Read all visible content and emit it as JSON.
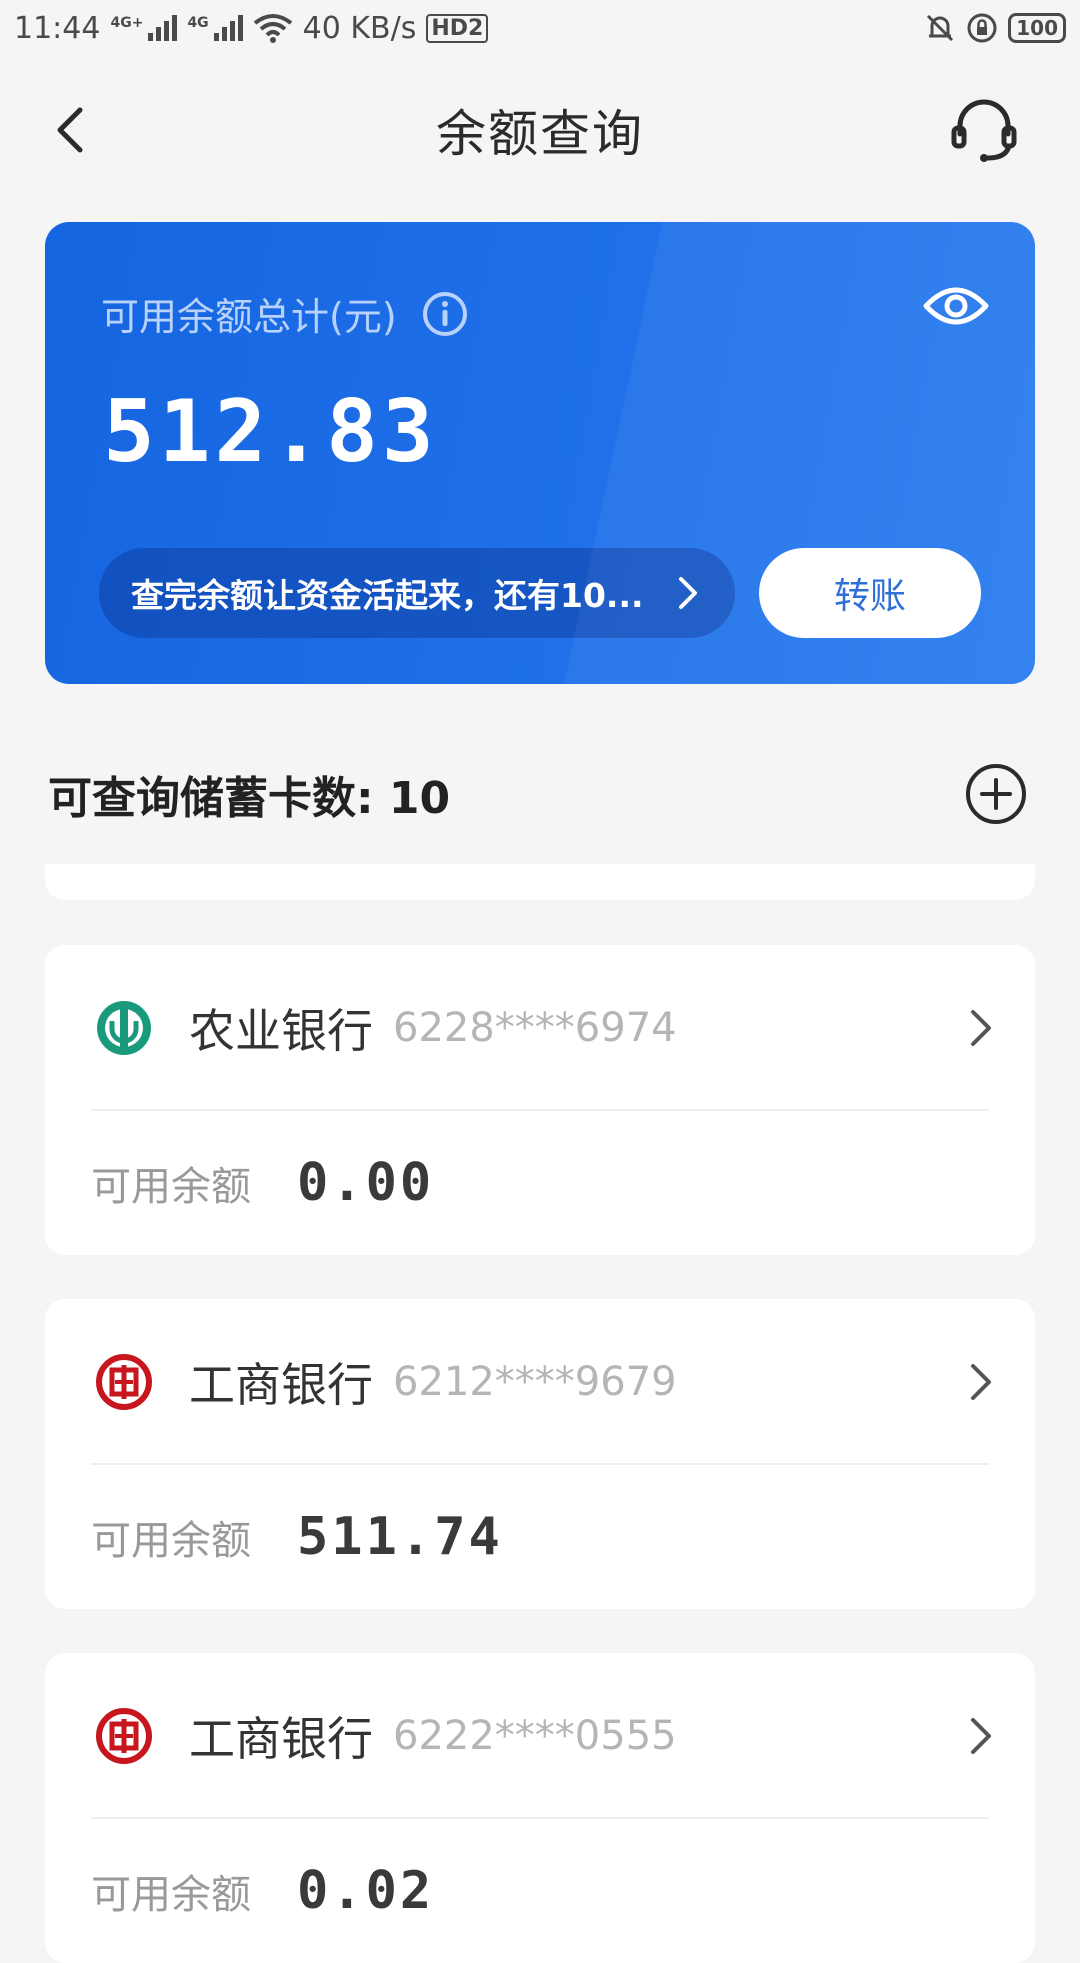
{
  "status_bar": {
    "time": "11:44",
    "net1": "4G+",
    "net2": "4G",
    "speed": "40 KB/s",
    "hd": "HD2",
    "battery": "100"
  },
  "header": {
    "title": "余额查询"
  },
  "summary": {
    "label": "可用余额总计(元)",
    "amount": "512.83",
    "promo": "查完余额让资金活起来，还有10...",
    "transfer_label": "转账"
  },
  "cards_section": {
    "title": "可查询储蓄卡数: 10"
  },
  "accounts": [
    {
      "bank": "农业银行",
      "number": "6228****6974",
      "balance_label": "可用余额",
      "balance": "0.00",
      "logo_color": "#1a9a7c"
    },
    {
      "bank": "工商银行",
      "number": "6212****9679",
      "balance_label": "可用余额",
      "balance": "511.74",
      "logo_color": "#c7161d"
    },
    {
      "bank": "工商银行",
      "number": "6222****0555",
      "balance_label": "可用余额",
      "balance": "0.02",
      "logo_color": "#c7161d"
    }
  ],
  "colors": {
    "accent_blue": "#1e6fe8",
    "transfer_text": "#2368d6",
    "abc_green": "#1a9a7c",
    "icbc_red": "#c7161d"
  }
}
